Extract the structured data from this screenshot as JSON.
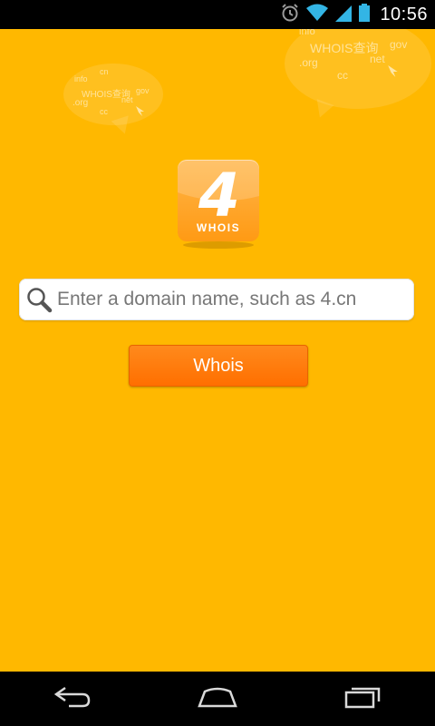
{
  "status_bar": {
    "time": "10:56",
    "icons": [
      "alarm-icon",
      "wifi-icon",
      "signal-icon",
      "battery-icon"
    ]
  },
  "app": {
    "background_color": "#FFB800",
    "decor_left_words": [
      "info",
      "cn",
      "WHOIS查询",
      "gov",
      ".org",
      "net",
      "cc"
    ],
    "decor_right_words": [
      "info",
      "WHOIS查询",
      ".org",
      "net",
      "gov",
      "cc"
    ],
    "logo": {
      "numeral": "4",
      "label": "WHOIS"
    },
    "search": {
      "placeholder": "Enter a domain name, such as 4.cn",
      "value": ""
    },
    "whois_button_label": "Whois"
  },
  "nav_bar": {
    "buttons": [
      "back-icon",
      "home-icon",
      "recent-apps-icon"
    ]
  }
}
